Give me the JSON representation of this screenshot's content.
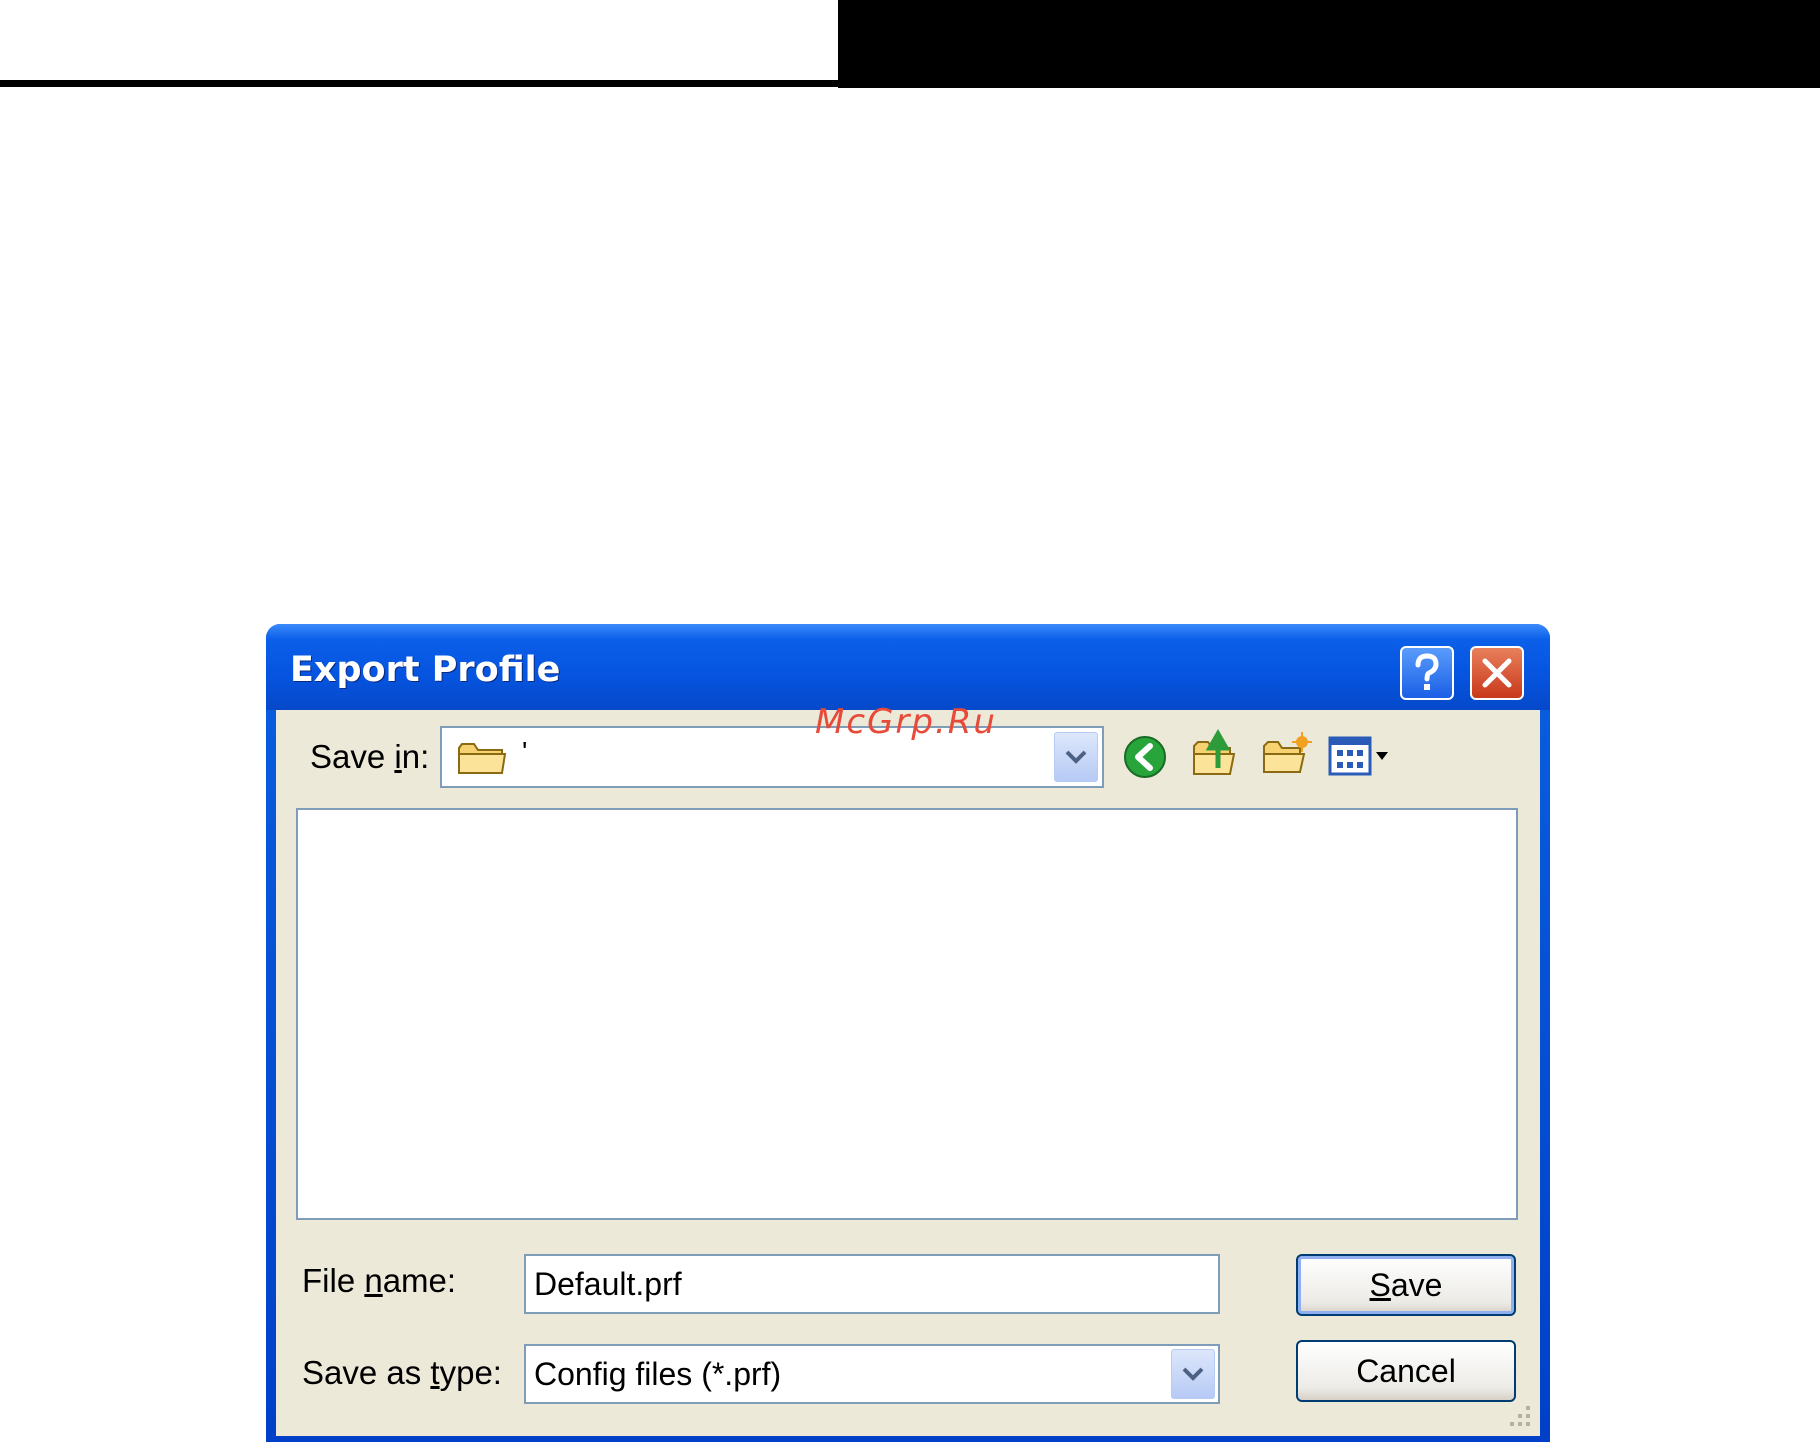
{
  "watermark": "McGrp.Ru",
  "dialog": {
    "title": "Export Profile",
    "save_in": {
      "label_pre": "Save ",
      "label_accel": "i",
      "label_post": "n:",
      "value": "'"
    },
    "file_name": {
      "label_pre": "File ",
      "label_accel": "n",
      "label_post": "ame:",
      "value": "Default.prf"
    },
    "save_as_type": {
      "label_pre": "Save as ",
      "label_accel": "t",
      "label_post": "ype:",
      "value": "Config files (*.prf)"
    },
    "buttons": {
      "save_accel": "S",
      "save_rest": "ave",
      "cancel": "Cancel"
    },
    "toolbar_icons": [
      "back-icon",
      "up-folder-icon",
      "new-folder-icon",
      "views-menu-icon"
    ]
  }
}
